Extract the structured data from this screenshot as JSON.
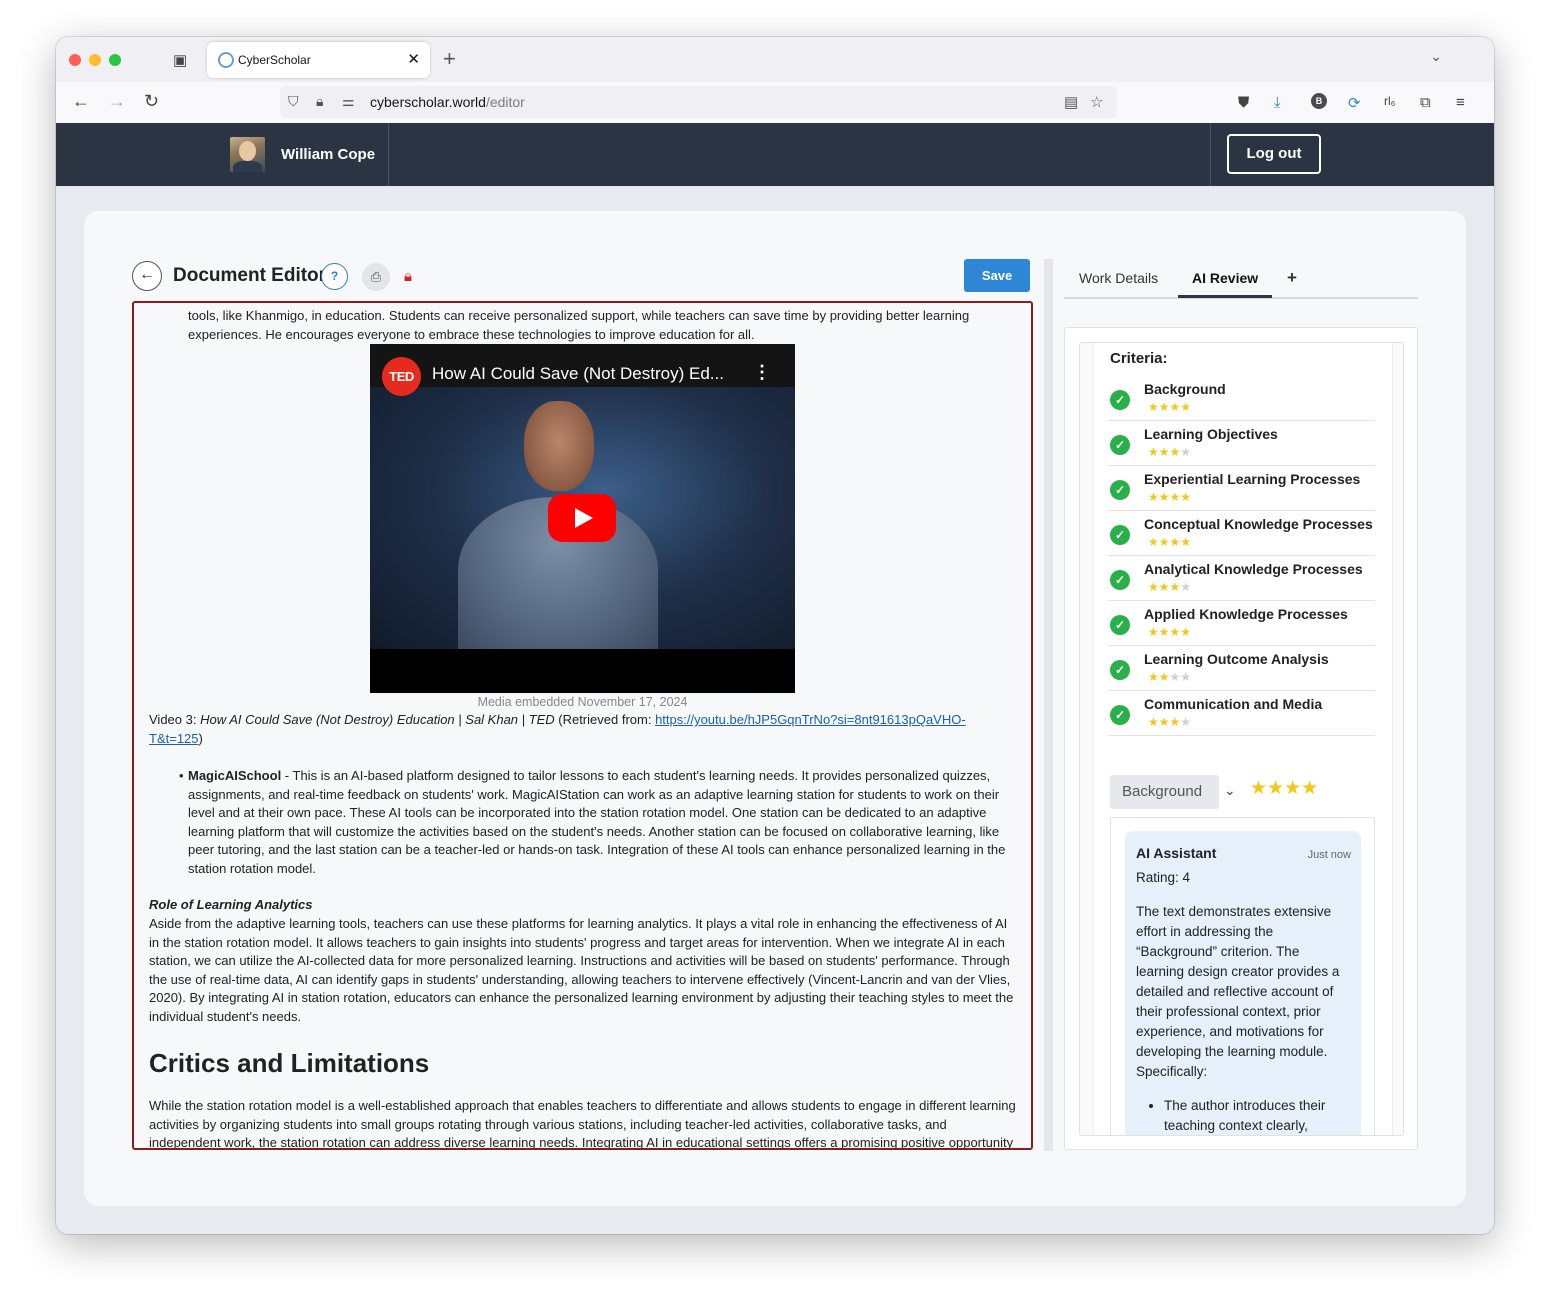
{
  "browser": {
    "tab_title": "CyberScholar",
    "url_domain": "cyberscholar.world",
    "url_path": "/editor"
  },
  "header": {
    "username": "William Cope",
    "logout_label": "Log out"
  },
  "editor": {
    "title": "Document Editor",
    "help_label": "?",
    "save_label": "Save",
    "para_top": "tools, like Khanmigo, in education. Students can receive personalized support, while teachers can save time by providing better learning experiences. He encourages everyone to embrace these technologies to improve education for all.",
    "video": {
      "logo": "TED",
      "title": "How AI Could Save (Not Destroy) Ed..."
    },
    "media_caption": "Media embedded November 17, 2024",
    "video_ref_prefix": "Video 3: ",
    "video_ref_title": "How AI Could Save (Not Destroy) Education | Sal Khan | TED",
    "video_ref_mid": " (Retrieved from: ",
    "video_ref_link": "https://youtu.be/hJP5GqnTrNo?si=8nt91613pQaVHO-T&t=125",
    "video_ref_end": ")",
    "bullet_title": "MagicAISchool",
    "bullet_text": " - This is an AI-based platform designed to tailor lessons to each student's learning needs. It provides personalized quizzes, assignments, and real-time feedback on students' work. MagicAIStation can work as an adaptive learning station for students to work on their level and at their own pace. These AI tools can be incorporated into the station rotation model. One station can be dedicated to an adaptive learning platform that will customize the activities based on the student's needs. Another station can be focused on collaborative learning, like peer tutoring, and the last station can be a teacher-led or hands-on task. Integration of these AI tools can enhance personalized learning in the station rotation model.",
    "section_heading": "Role of Learning Analytics",
    "section_text": "Aside from the adaptive learning tools, teachers can use these platforms for learning analytics. It plays a vital role in enhancing the effectiveness of AI in the station rotation model. It allows teachers to gain insights into students' progress and target areas for intervention. When we integrate AI in each station, we can utilize the AI-collected data for more personalized learning. Instructions and activities will be based on students' performance. Through the use of real-time data, AI can identify gaps in students' understanding, allowing teachers to intervene effectively (Vincent-Lancrin and van der Vlies, 2020). By integrating AI in station rotation, educators can enhance the personalized learning environment by adjusting their teaching styles to meet the individual student's needs.",
    "critics_heading": "Critics and Limitations",
    "critics_text": "While the station rotation model is a well-established approach that enables teachers to differentiate and allows students to engage in different learning activities by organizing students into small groups rotating through various stations, including teacher-led activities, collaborative tasks, and independent work, the station rotation can address diverse learning needs. Integrating AI in educational settings offers a promising positive opportunity"
  },
  "right_panel": {
    "tabs": [
      {
        "label": "Work Details"
      },
      {
        "label": "AI Review"
      }
    ],
    "add_tab_label": "+",
    "criteria_title": "Criteria:",
    "criteria": [
      {
        "name": "Background",
        "rating": 4,
        "stars": "★★★★"
      },
      {
        "name": "Learning Objectives",
        "rating": 3,
        "stars": "★★★"
      },
      {
        "name": "Experiential Learning Processes",
        "rating": 4,
        "stars": "★★★★"
      },
      {
        "name": "Conceptual Knowledge Processes",
        "rating": 4,
        "stars": "★★★★"
      },
      {
        "name": "Analytical Knowledge Processes",
        "rating": 3,
        "stars": "★★★"
      },
      {
        "name": "Applied Knowledge Processes",
        "rating": 4,
        "stars": "★★★★"
      },
      {
        "name": "Learning Outcome Analysis",
        "rating": 2,
        "stars": "★★"
      },
      {
        "name": "Communication and Media",
        "rating": 3,
        "stars": "★★★"
      }
    ],
    "selected_criterion": "Background",
    "selected_rating": 4,
    "selected_stars": "★★★★",
    "message": {
      "author": "AI Assistant",
      "time": "Just now",
      "rating": "Rating: 4",
      "body": "The text demonstrates extensive effort in addressing the “Background” criterion. The learning design creator provides a detailed and reflective account of their professional context, prior experience, and motivations for developing the learning module. Specifically:",
      "list_item": "The author introduces their teaching context clearly,"
    }
  },
  "colors": {
    "appbar": "#2b3443",
    "save_button": "#2e86d6",
    "editor_border": "#8b1c1c",
    "check": "#2ab04a",
    "star": "#f5c518",
    "message_bg": "#e5f0fb"
  }
}
